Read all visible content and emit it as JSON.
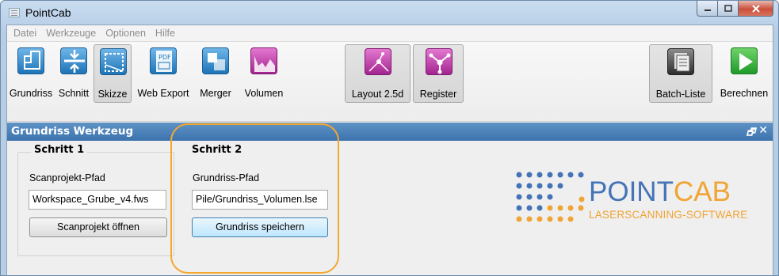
{
  "window": {
    "title": "PointCab"
  },
  "menu": [
    "Datei",
    "Werkzeuge",
    "Optionen",
    "Hilfe"
  ],
  "toolbar": {
    "tools": [
      {
        "label": "Grundriss",
        "icon": "floorplan-icon",
        "color": "#1d74b7"
      },
      {
        "label": "Schnitt",
        "icon": "section-icon",
        "color": "#1d74b7"
      },
      {
        "label": "Skizze",
        "icon": "sketch-icon",
        "color": "#1d74b7",
        "pressed": true
      },
      {
        "label": "Web Export",
        "icon": "pdf-export-icon",
        "color": "#1d74b7"
      },
      {
        "label": "Merger",
        "icon": "merger-icon",
        "color": "#1d74b7"
      },
      {
        "label": "Volumen",
        "icon": "volume-icon",
        "color": "#a2258f"
      },
      {
        "label": "Layout 2.5d",
        "icon": "layout-icon",
        "color": "#a2258f",
        "pressed": true
      },
      {
        "label": "Register",
        "icon": "register-icon",
        "color": "#a2258f",
        "pressed": true
      },
      {
        "label": "Batch-Liste",
        "icon": "batch-list-icon",
        "color": "#2e2e2e",
        "pressed": true
      },
      {
        "label": "Berechnen",
        "icon": "play-icon",
        "color": "#1e9b2a"
      }
    ]
  },
  "panel": {
    "title": "Grundriss Werkzeug",
    "float_glyph": "🗗",
    "close_glyph": "✕",
    "step1": {
      "title": "Schritt 1",
      "label": "Scanprojekt-Pfad",
      "value": "Workspace_Grube_v4.fws",
      "button": "Scanprojekt öffnen"
    },
    "step2": {
      "title": "Schritt 2",
      "label": "Grundriss-Pfad",
      "value": "Pile/Grundriss_Volumen.lse",
      "button": "Grundriss speichern"
    }
  },
  "logo": {
    "word_part1": "POINT",
    "word_part2": "CAB",
    "subtitle": "LASERSCANNING-SOFTWARE",
    "colors": {
      "blue": "#4473b7",
      "orange": "#f0a433"
    }
  },
  "highlight_color": "#f4a72e"
}
